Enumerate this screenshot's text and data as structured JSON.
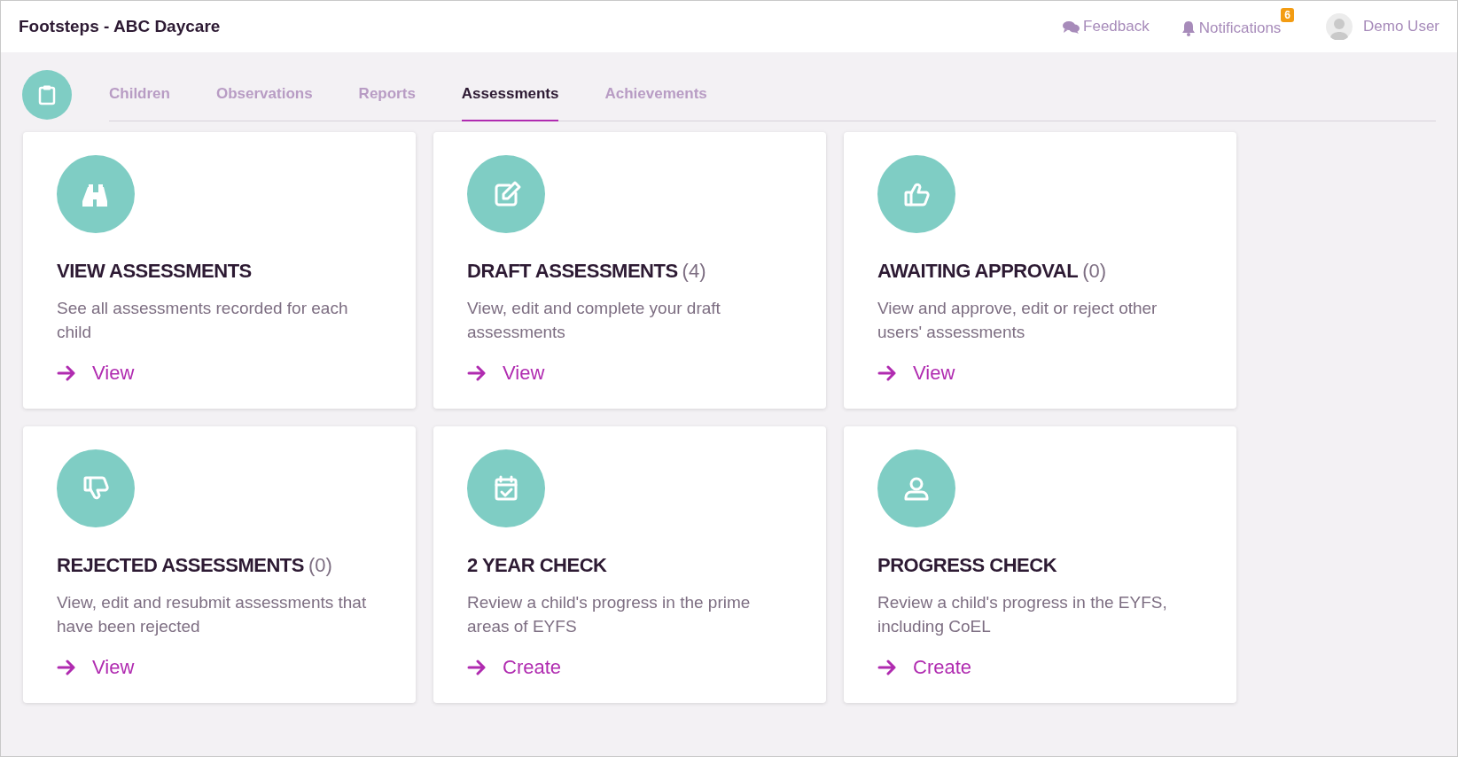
{
  "header": {
    "title": "Footsteps - ABC Daycare",
    "feedback": "Feedback",
    "notifications": "Notifications",
    "notification_count": "6",
    "user": "Demo User"
  },
  "tabs": [
    {
      "label": "Children",
      "selected": false
    },
    {
      "label": "Observations",
      "selected": false
    },
    {
      "label": "Reports",
      "selected": false
    },
    {
      "label": "Assessments",
      "selected": true
    },
    {
      "label": "Achievements",
      "selected": false
    }
  ],
  "cards": [
    {
      "kind": "binoculars",
      "title": "VIEW ASSESSMENTS",
      "description": "See all assessments recorded for each child",
      "link": "View"
    },
    {
      "kind": "edit",
      "title": "DRAFT ASSESSMENTS",
      "count": "(4)",
      "description": "View, edit and complete your draft assessments",
      "link": "View"
    },
    {
      "kind": "thumbs-up",
      "title": "AWAITING APPROVAL",
      "count": "(0)",
      "description": "View and approve, edit or reject other users' assessments",
      "link": "View"
    },
    {
      "kind": "thumbs-down",
      "title": "REJECTED ASSESSMENTS",
      "count": "(0)",
      "description": "View, edit and resubmit assessments that have been rejected",
      "link": "View"
    },
    {
      "kind": "calendar-check",
      "title": "2 YEAR CHECK",
      "description": "Review a child's progress in the prime areas of EYFS",
      "link": "Create"
    },
    {
      "kind": "user",
      "title": "PROGRESS CHECK",
      "description": "Review a child's progress in the EYFS, including CoEL",
      "link": "Create"
    }
  ]
}
